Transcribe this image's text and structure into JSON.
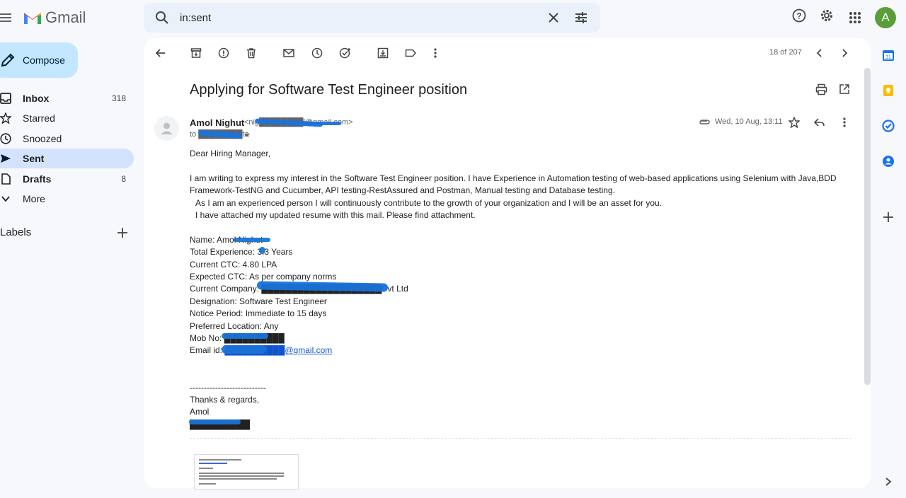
{
  "header": {
    "app_name": "Gmail",
    "search_value": "in:sent",
    "avatar_letter": "A",
    "avatar_color": "#5a9e3a"
  },
  "sidebar": {
    "compose_label": "Compose",
    "items": [
      {
        "label": "Inbox",
        "count": "318",
        "icon": "inbox-icon"
      },
      {
        "label": "Starred",
        "count": "",
        "icon": "star-icon"
      },
      {
        "label": "Snoozed",
        "count": "",
        "icon": "clock-icon"
      },
      {
        "label": "Sent",
        "count": "",
        "icon": "send-icon"
      },
      {
        "label": "Drafts",
        "count": "8",
        "icon": "draft-icon"
      },
      {
        "label": "More",
        "count": "",
        "icon": "chevron-down-icon"
      }
    ],
    "labels_heading": "Labels"
  },
  "toolbar": {
    "pager": "18 of 207"
  },
  "message": {
    "subject": "Applying for Software Test Engineer position",
    "sender_name": "Amol Nighut",
    "sender_email": "<nig████████l@gmail.com>",
    "to_line": "to ████████ta",
    "date": "Wed, 10 Aug, 13:11",
    "greeting": "Dear Hiring Manager,",
    "para1_line1": "I am writing to express my interest in the Software Test Engineer position. I have Experience in Automation testing of web-based applications using Selenium with Java,BDD",
    "para1_line2": "Framework-TestNG and Cucumber, API testing-RestAssured and Postman, Manual testing and Database testing.",
    "para2": "As I am an experienced person I will continuously contribute to the growth of your organization and I will be an asset for you.",
    "para3": "I have attached my updated resume with this mail. Please find attachment.",
    "name_line": "Name: Amol Nighut",
    "experience_line": "Total Experience: 3.3 Years",
    "ctc_line": "Current CTC: 4.80 LPA",
    "expected_line": "Expected CTC: As per company norms",
    "company_line": "Current Company: ████████████████████Pvt Ltd",
    "designation_line": "Designation: Software Test Engineer",
    "notice_line": "Notice Period: Immediate to 15 days",
    "location_line": "Preferred Location: Any",
    "mob_line": "Mob No: ██████████",
    "email_label": "Email id: ",
    "email_value": "██████████@gmail.com",
    "divider": "---------------------------",
    "thanks": "Thanks & regards,",
    "signature": "Amol",
    "sign_phone": "██████████"
  },
  "colors": {
    "accent": "#0b57d0",
    "compose_bg": "#c2e7ff",
    "active_nav_bg": "#d3e3fd",
    "redaction": "#1a73d9"
  }
}
